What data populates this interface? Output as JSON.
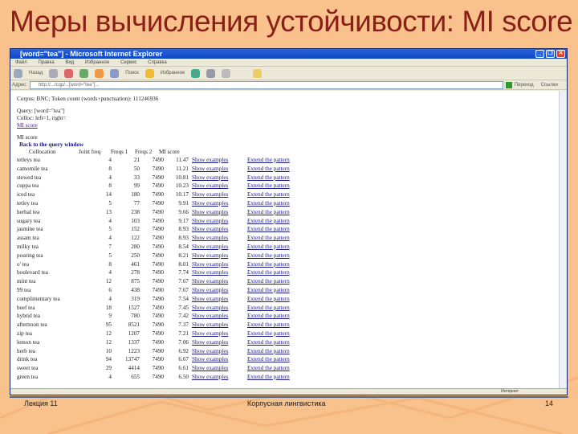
{
  "slide": {
    "title": "Меры вычисления устойчивости: MI score",
    "footer_left": "Лекция 11",
    "footer_center": "Корпусная лингвистика",
    "footer_right": "14"
  },
  "window": {
    "title": "[word=\"tea\"] - Microsoft Internet Explorer",
    "menu": [
      "Файл",
      "Правка",
      "Вид",
      "Избранное",
      "Сервис",
      "Справка"
    ],
    "toolbar": [
      "Назад",
      "Поиск",
      "Избранное"
    ],
    "address_label": "Адрес:",
    "address": "http://.../cqp/...[word=\"tea\"]...",
    "go_label": "Переход",
    "links_label": "Ссылки"
  },
  "page": {
    "corpus": "Corpus: BNC; Token count (words+punctuation): 111246936",
    "query": "Query: [word=\"tea\"]",
    "colloc": "Colloc: left=1, right=",
    "mi_link": "MI score",
    "section": "MI score",
    "back": "Back to the query window",
    "headers": [
      "Collocation",
      "Joint freq",
      "Freqs 1",
      "Freqs 2",
      "MI score"
    ],
    "show": "Show examples",
    "extend": "Extend the pattern",
    "rows": [
      [
        "tetleys tea",
        "4",
        "21",
        "7490",
        "11.47"
      ],
      [
        "camomile tea",
        "8",
        "50",
        "7490",
        "11.21"
      ],
      [
        "stewed tea",
        "4",
        "33",
        "7490",
        "10.81"
      ],
      [
        "cuppa tea",
        "8",
        "99",
        "7490",
        "10.23"
      ],
      [
        "iced tea",
        "14",
        "180",
        "7490",
        "10.17"
      ],
      [
        "tetley tea",
        "5",
        "77",
        "7490",
        "9.91"
      ],
      [
        "herbal tea",
        "13",
        "238",
        "7490",
        "9.66"
      ],
      [
        "sugary tea",
        "4",
        "103",
        "7490",
        "9.17"
      ],
      [
        "jasmine tea",
        "5",
        "152",
        "7490",
        "8.93"
      ],
      [
        "assam tea",
        "4",
        "122",
        "7490",
        "8.93"
      ],
      [
        "milky tea",
        "7",
        "280",
        "7490",
        "8.54"
      ],
      [
        "pouring tea",
        "5",
        "250",
        "7490",
        "8.21"
      ],
      [
        "o' tea",
        "8",
        "461",
        "7490",
        "8.01"
      ],
      [
        "boulevard tea",
        "4",
        "278",
        "7490",
        "7.74"
      ],
      [
        "mint tea",
        "12",
        "875",
        "7490",
        "7.67"
      ],
      [
        "99 tea",
        "6",
        "438",
        "7490",
        "7.67"
      ],
      [
        "complimentary tea",
        "4",
        "319",
        "7490",
        "7.54"
      ],
      [
        "beef tea",
        "18",
        "1527",
        "7490",
        "7.45"
      ],
      [
        "hybrid tea",
        "9",
        "780",
        "7490",
        "7.42"
      ],
      [
        "afternoon tea",
        "95",
        "8521",
        "7490",
        "7.37"
      ],
      [
        "zip tea",
        "12",
        "1207",
        "7490",
        "7.21"
      ],
      [
        "lemon tea",
        "12",
        "1337",
        "7490",
        "7.06"
      ],
      [
        "herb tea",
        "10",
        "1223",
        "7490",
        "6.92"
      ],
      [
        "drink tea",
        "94",
        "13747",
        "7490",
        "6.67"
      ],
      [
        "sweet tea",
        "29",
        "4414",
        "7490",
        "6.61"
      ],
      [
        "green tea",
        "4",
        "655",
        "7490",
        "6.50"
      ]
    ]
  },
  "status": {
    "zone": "Интернет"
  }
}
